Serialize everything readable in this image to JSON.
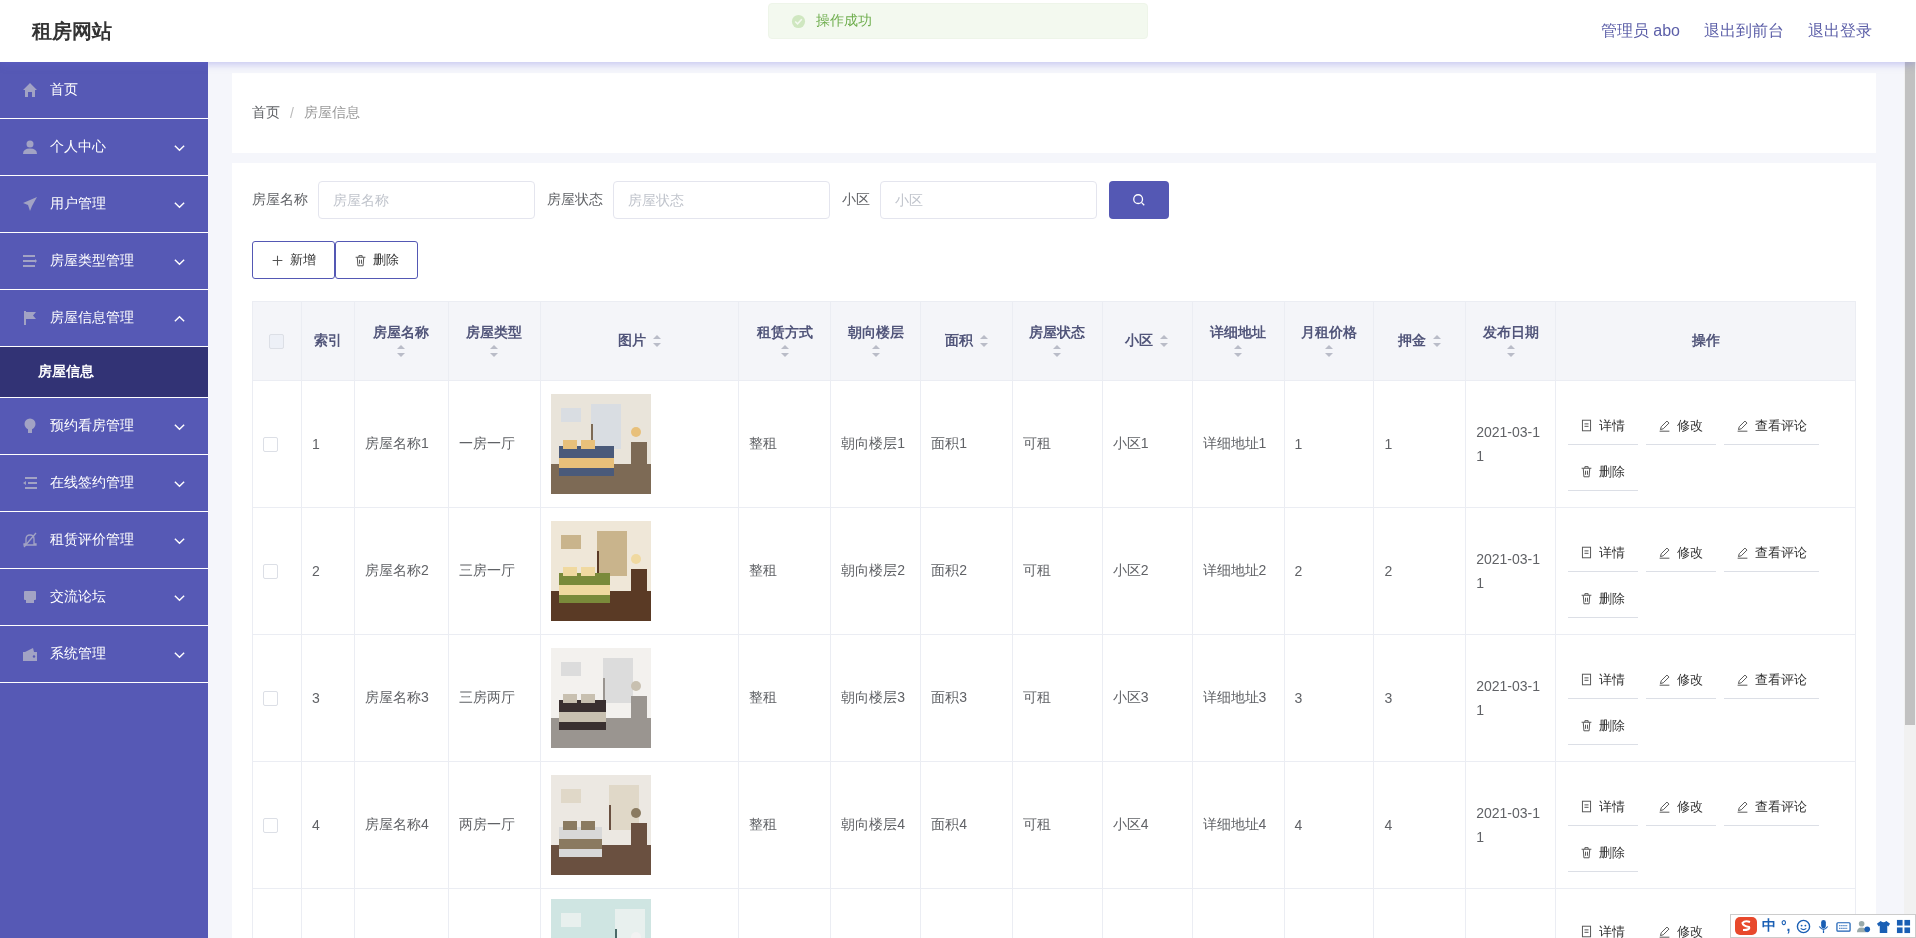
{
  "site_title": "租房网站",
  "toast": {
    "text": "操作成功"
  },
  "header_links": [
    "管理员 abo",
    "退出到前台",
    "退出登录"
  ],
  "sidebar": {
    "items": [
      {
        "label": "首页",
        "kind": "link"
      },
      {
        "label": "个人中心",
        "kind": "group",
        "expanded": false
      },
      {
        "label": "用户管理",
        "kind": "group",
        "expanded": false
      },
      {
        "label": "房屋类型管理",
        "kind": "group",
        "expanded": false
      },
      {
        "label": "房屋信息管理",
        "kind": "group",
        "expanded": true,
        "children": [
          {
            "label": "房屋信息",
            "selected": true
          }
        ]
      },
      {
        "label": "预约看房管理",
        "kind": "group",
        "expanded": false
      },
      {
        "label": "在线签约管理",
        "kind": "group",
        "expanded": false
      },
      {
        "label": "租赁评价管理",
        "kind": "group",
        "expanded": false
      },
      {
        "label": "交流论坛",
        "kind": "group",
        "expanded": false
      },
      {
        "label": "系统管理",
        "kind": "group",
        "expanded": false
      }
    ]
  },
  "breadcrumb": {
    "separator": "/",
    "items": [
      "首页",
      "房屋信息"
    ]
  },
  "filters": [
    {
      "label": "房屋名称",
      "placeholder": "房屋名称"
    },
    {
      "label": "房屋状态",
      "placeholder": "房屋状态"
    },
    {
      "label": "小区",
      "placeholder": "小区"
    }
  ],
  "actions": [
    {
      "label": "新增",
      "kind": "add"
    },
    {
      "label": "删除",
      "kind": "delete"
    }
  ],
  "table": {
    "columns": [
      {
        "kind": "checkbox",
        "checked": false
      },
      {
        "kind": "text",
        "label": "索引",
        "sortable": false
      },
      {
        "kind": "text",
        "label": "房屋名称",
        "sortable": true
      },
      {
        "kind": "text",
        "label": "房屋类型",
        "sortable": true
      },
      {
        "kind": "text",
        "label": "图片",
        "sortable": true
      },
      {
        "kind": "text",
        "label": "租赁方式",
        "sortable": true
      },
      {
        "kind": "text",
        "label": "朝向楼层",
        "sortable": true
      },
      {
        "kind": "text",
        "label": "面积",
        "sortable": true
      },
      {
        "kind": "text",
        "label": "房屋状态",
        "sortable": true
      },
      {
        "kind": "text",
        "label": "小区",
        "sortable": true
      },
      {
        "kind": "text",
        "label": "详细地址",
        "sortable": true
      },
      {
        "kind": "text",
        "label": "月租价格",
        "sortable": true
      },
      {
        "kind": "text",
        "label": "押金",
        "sortable": true
      },
      {
        "kind": "text",
        "label": "发布日期",
        "sortable": true
      },
      {
        "kind": "text",
        "label": "操作",
        "sortable": false
      }
    ],
    "rows": [
      {
        "checked": false,
        "index": "1",
        "name": "房屋名称1",
        "type": "一房一厅",
        "picture": {
          "kind": "picture"
        },
        "rent_mode": "整租",
        "orientation": "朝向楼层1",
        "area": "面积1",
        "status": "可租",
        "community": "小区1",
        "address": "详细地址1",
        "price": "1",
        "deposit": "1",
        "date": "2021-03-11",
        "actions": [
          {
            "label": "详情",
            "kind": "detail"
          },
          {
            "label": "修改",
            "kind": "edit"
          },
          {
            "label": "查看评论",
            "kind": "edit"
          },
          {
            "label": "删除",
            "kind": "delete"
          }
        ]
      },
      {
        "checked": false,
        "index": "2",
        "name": "房屋名称2",
        "type": "三房一厅",
        "picture": {
          "kind": "picture"
        },
        "rent_mode": "整租",
        "orientation": "朝向楼层2",
        "area": "面积2",
        "status": "可租",
        "community": "小区2",
        "address": "详细地址2",
        "price": "2",
        "deposit": "2",
        "date": "2021-03-11",
        "actions": [
          {
            "label": "详情",
            "kind": "detail"
          },
          {
            "label": "修改",
            "kind": "edit"
          },
          {
            "label": "查看评论",
            "kind": "edit"
          },
          {
            "label": "删除",
            "kind": "delete"
          }
        ]
      },
      {
        "checked": false,
        "index": "3",
        "name": "房屋名称3",
        "type": "三房两厅",
        "picture": {
          "kind": "picture"
        },
        "rent_mode": "整租",
        "orientation": "朝向楼层3",
        "area": "面积3",
        "status": "可租",
        "community": "小区3",
        "address": "详细地址3",
        "price": "3",
        "deposit": "3",
        "date": "2021-03-11",
        "actions": [
          {
            "label": "详情",
            "kind": "detail"
          },
          {
            "label": "修改",
            "kind": "edit"
          },
          {
            "label": "查看评论",
            "kind": "edit"
          },
          {
            "label": "删除",
            "kind": "delete"
          }
        ]
      },
      {
        "checked": false,
        "index": "4",
        "name": "房屋名称4",
        "type": "两房一厅",
        "picture": {
          "kind": "picture"
        },
        "rent_mode": "整租",
        "orientation": "朝向楼层4",
        "area": "面积4",
        "status": "可租",
        "community": "小区4",
        "address": "详细地址4",
        "price": "4",
        "deposit": "4",
        "date": "2021-03-11",
        "actions": [
          {
            "label": "详情",
            "kind": "detail"
          },
          {
            "label": "修改",
            "kind": "edit"
          },
          {
            "label": "查看评论",
            "kind": "edit"
          },
          {
            "label": "删除",
            "kind": "delete"
          }
        ]
      },
      {
        "picture": {
          "kind": "picture"
        },
        "actions": [
          {
            "label": "详情",
            "kind": "detail"
          },
          {
            "label": "修改",
            "kind": "edit"
          }
        ]
      }
    ]
  },
  "ime_bar": {
    "items": [
      "中",
      "°,"
    ]
  }
}
